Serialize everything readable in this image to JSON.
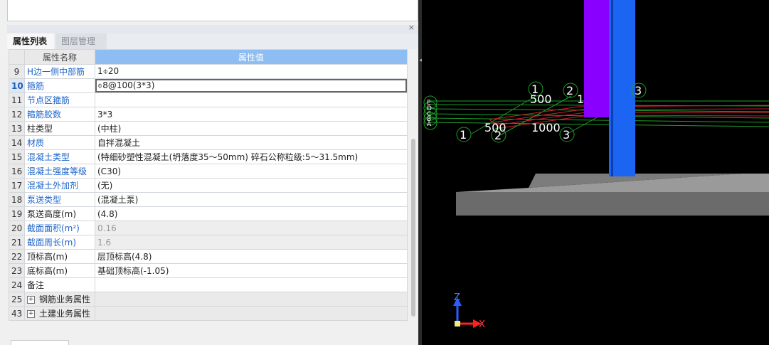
{
  "panel": {
    "close_icon": "×",
    "tabs": [
      {
        "label": "属性列表",
        "active": true
      },
      {
        "label": "图层管理",
        "active": false
      }
    ],
    "header": {
      "col_name": "属性名称",
      "col_value": "属性值"
    },
    "rows": [
      {
        "no": "9",
        "name": "H边一侧中部筋",
        "value": "1⌽20"
      },
      {
        "no": "10",
        "name": "箍筋",
        "value": "⌽8@100(3*3)"
      },
      {
        "no": "11",
        "name": "节点区箍筋",
        "value": ""
      },
      {
        "no": "12",
        "name": "箍筋胶数",
        "value": "3*3"
      },
      {
        "no": "13",
        "name": "柱类型",
        "value": "(中柱)"
      },
      {
        "no": "14",
        "name": "材质",
        "value": "自拌混凝土"
      },
      {
        "no": "15",
        "name": "混凝土类型",
        "value": "(特细砂塑性混凝土(坍落度35～50mm) 碎石公称粒级:5～31.5mm)"
      },
      {
        "no": "16",
        "name": "混凝土强度等级",
        "value": "(C30)"
      },
      {
        "no": "17",
        "name": "混凝土外加剂",
        "value": "(无)"
      },
      {
        "no": "18",
        "name": "泵送类型",
        "value": "(混凝土泵)"
      },
      {
        "no": "19",
        "name": "泵送高度(m)",
        "value": "(4.8)"
      },
      {
        "no": "20",
        "name": "截面面积(m²)",
        "value": "0.16"
      },
      {
        "no": "21",
        "name": "截面周长(m)",
        "value": "1.6"
      },
      {
        "no": "22",
        "name": "顶标高(m)",
        "value": "层顶标高(4.8)"
      },
      {
        "no": "23",
        "name": "底标高(m)",
        "value": "基础顶标高(-1.05)"
      },
      {
        "no": "24",
        "name": "备注",
        "value": ""
      },
      {
        "no": "25",
        "name": "钢筋业务属性",
        "value": ""
      },
      {
        "no": "43",
        "name": "土建业务属性",
        "value": ""
      }
    ],
    "expand_icon": "+"
  },
  "viewport": {
    "axis_labels": [
      {
        "num": "1",
        "left": "1"
      },
      {
        "num": "2",
        "left": "2"
      },
      {
        "num": "3",
        "left": "3"
      }
    ],
    "dims": [
      "500",
      "1000",
      "500",
      "1"
    ],
    "grid_nums": [
      "1",
      "2",
      "3",
      "1",
      "2",
      "3"
    ],
    "side_labels": [
      "E",
      "D",
      "C",
      "B",
      "A"
    ],
    "axis_z": "Z",
    "axis_x": "X",
    "colors": {
      "purple_column": "#8a00ff",
      "blue_column": "#1c64f2",
      "grid_green": "#1d9e2a",
      "rebar_red": "#d11a2a",
      "slab_gray": "#6b6b6b"
    }
  }
}
